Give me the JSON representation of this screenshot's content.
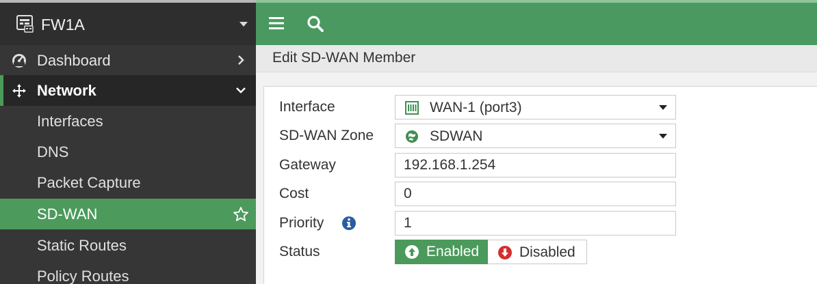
{
  "device": {
    "name": "FW1A",
    "icon": "firewall-icon"
  },
  "nav": {
    "dashboard": "Dashboard",
    "network": "Network",
    "items": [
      "Interfaces",
      "DNS",
      "Packet Capture",
      "SD-WAN",
      "Static Routes",
      "Policy Routes"
    ],
    "active": "SD-WAN"
  },
  "page": {
    "title": "Edit SD-WAN Member"
  },
  "form": {
    "interface": {
      "label": "Interface",
      "value": "WAN-1 (port3)"
    },
    "zone": {
      "label": "SD-WAN Zone",
      "value": "SDWAN"
    },
    "gateway": {
      "label": "Gateway",
      "value": "192.168.1.254"
    },
    "cost": {
      "label": "Cost",
      "value": "0"
    },
    "priority": {
      "label": "Priority",
      "value": "1"
    },
    "status": {
      "label": "Status",
      "enabled": "Enabled",
      "disabled": "Disabled",
      "selected": "Enabled"
    }
  },
  "colors": {
    "accent": "#4a9960",
    "sidebar": "#363636",
    "disabled_icon": "#d32f2f",
    "info_icon": "#2a5d9f"
  }
}
